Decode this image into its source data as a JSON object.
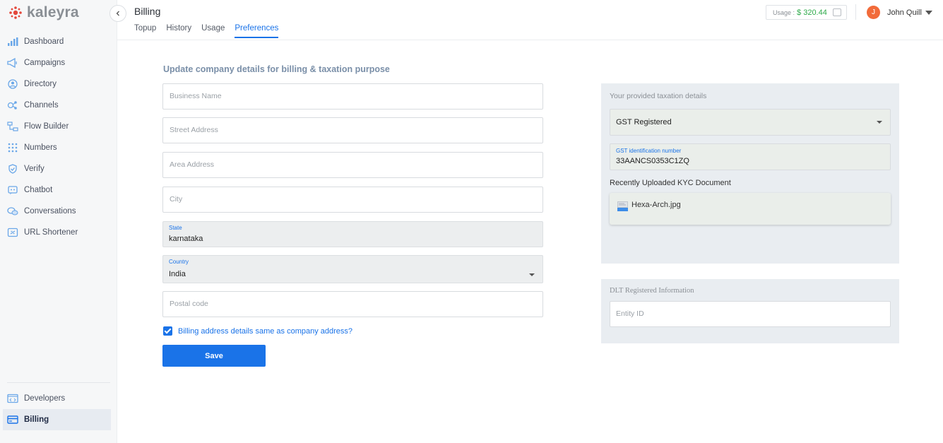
{
  "brand": {
    "name": "kaleyra",
    "accent": "#1a73e8",
    "logo_color": "#e4473b"
  },
  "sidebar": {
    "items": [
      {
        "label": "Dashboard",
        "icon": "bar-chart-icon"
      },
      {
        "label": "Campaigns",
        "icon": "megaphone-icon"
      },
      {
        "label": "Directory",
        "icon": "person-circle-icon"
      },
      {
        "label": "Channels",
        "icon": "channels-icon"
      },
      {
        "label": "Flow Builder",
        "icon": "flow-icon"
      },
      {
        "label": "Numbers",
        "icon": "dial-pad-icon"
      },
      {
        "label": "Verify",
        "icon": "shield-check-icon"
      },
      {
        "label": "Chatbot",
        "icon": "chatbot-icon"
      },
      {
        "label": "Conversations",
        "icon": "chat-bubbles-icon"
      },
      {
        "label": "URL Shortener",
        "icon": "link-icon"
      }
    ],
    "bottom_items": [
      {
        "label": "Developers",
        "icon": "code-window-icon"
      },
      {
        "label": "Billing",
        "icon": "credit-card-icon",
        "active": true
      }
    ]
  },
  "header": {
    "title": "Billing",
    "tabs": [
      {
        "label": "Topup"
      },
      {
        "label": "History"
      },
      {
        "label": "Usage"
      },
      {
        "label": "Preferences",
        "active": true
      }
    ],
    "usage_label": "Usage :",
    "usage_amount": "$ 320.44",
    "user": {
      "initial": "J",
      "name": "John Quill"
    }
  },
  "form": {
    "heading": "Update company details for billing & taxation purpose",
    "business_name_placeholder": "Business Name",
    "street_placeholder": "Street Address",
    "area_placeholder": "Area Address",
    "city_placeholder": "City",
    "state_label": "State",
    "state_value": "karnataka",
    "country_label": "Country",
    "country_value": "India",
    "postal_placeholder": "Postal code",
    "same_address_label": "Billing address details same as company address?",
    "same_address_checked": true,
    "save_label": "Save"
  },
  "taxation": {
    "title": "Your provided taxation details",
    "gst_type": "GST Registered",
    "gst_id_label": "GST identification number",
    "gst_id_value": "33AANCS0353C1ZQ",
    "kyc_title": "Recently Uploaded KYC Document",
    "kyc_file": "Hexa-Arch.jpg"
  },
  "dlt": {
    "title": "DLT Registered Information",
    "entity_placeholder": "Entity ID"
  }
}
